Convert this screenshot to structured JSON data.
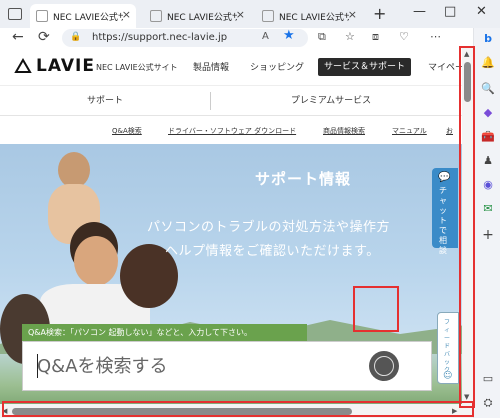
{
  "browser": {
    "tabs": [
      {
        "label": "NEC LAVIE公式サイト",
        "active": true
      },
      {
        "label": "NEC LAVIE公式サイト",
        "active": false
      },
      {
        "label": "NEC LAVIE公式サイト",
        "active": false
      }
    ],
    "close_glyph": "×",
    "new_tab_glyph": "+",
    "window_controls": [
      "—",
      "□",
      "✕"
    ],
    "nav_icons": [
      "←",
      "⟳"
    ],
    "url": "https://support.nec-lavie.jp",
    "url_icons": [
      "A",
      "★"
    ],
    "toolbar_icons": [
      "⧉",
      "☆",
      "⧈",
      "♡",
      "⋯"
    ]
  },
  "edge_sidebar": {
    "icons": [
      "b",
      "🔔",
      "🔍",
      "◆",
      "🧰",
      "♟",
      "◉",
      "✉",
      "+",
      "▭",
      "⛭"
    ]
  },
  "site": {
    "logo_text": "LAVIE",
    "site_name": "NEC LAVIE公式サイト",
    "nav": [
      "製品情報",
      "ショッピング",
      "サービス＆サポート",
      "マイペー"
    ],
    "subnav": [
      "サポート",
      "プレミアムサービス"
    ],
    "links": [
      "Q&A検索",
      "ドライバー・ソフトウェア ダウンロード",
      "商品情報検索",
      "マニュアル",
      "お"
    ]
  },
  "hero": {
    "title": "サポート情報",
    "desc_line1": "パソコンのトラブルの対処方法や操作方",
    "desc_line2": "ヘルプ情報をご確認いただけます。",
    "chat_tab": "チャットで相談",
    "feedback_tab": "フィードバック",
    "qa_tip": "Q&A検索：「パソコン 起動しない」などと、入力して下さい。",
    "search_placeholder": "Q&Aを検索する"
  },
  "colors": {
    "highlight": "#e53030",
    "tip_green": "#6aa24d",
    "chat_blue": "#3a8bc8",
    "nav_active_bg": "#2a2a2a"
  }
}
